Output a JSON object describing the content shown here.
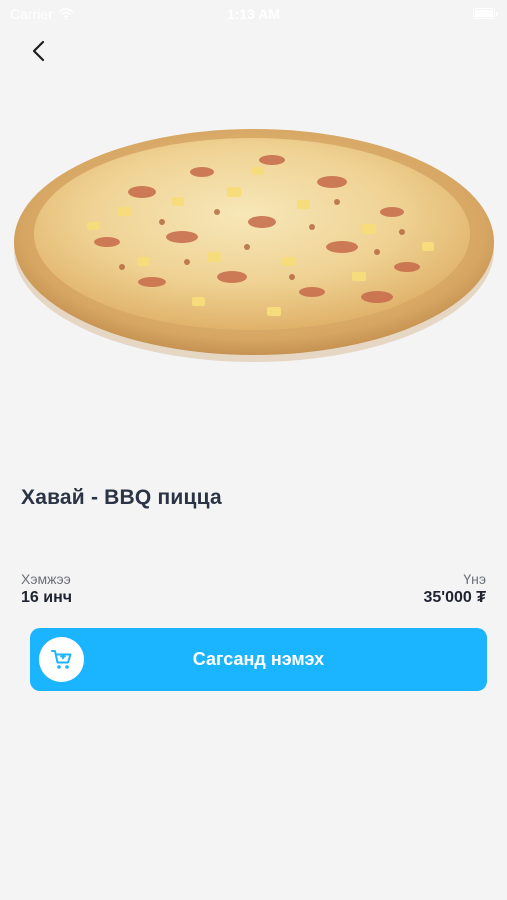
{
  "status_bar": {
    "carrier": "Carrier",
    "time": "1:13 AM"
  },
  "product": {
    "title": "Хавай - BBQ пицца",
    "size_label": "Хэмжээ",
    "size_value": "16 инч",
    "price_label": "Үнэ",
    "price_value": "35'000 ₮"
  },
  "actions": {
    "add_to_cart_label": "Сагсанд нэмэх"
  },
  "colors": {
    "accent": "#1ab4ff",
    "background": "#f4f4f4",
    "title_text": "#2b3445"
  },
  "icons": {
    "back": "chevron-left-icon",
    "cart": "cart-icon",
    "wifi": "wifi-icon",
    "battery": "battery-icon"
  }
}
